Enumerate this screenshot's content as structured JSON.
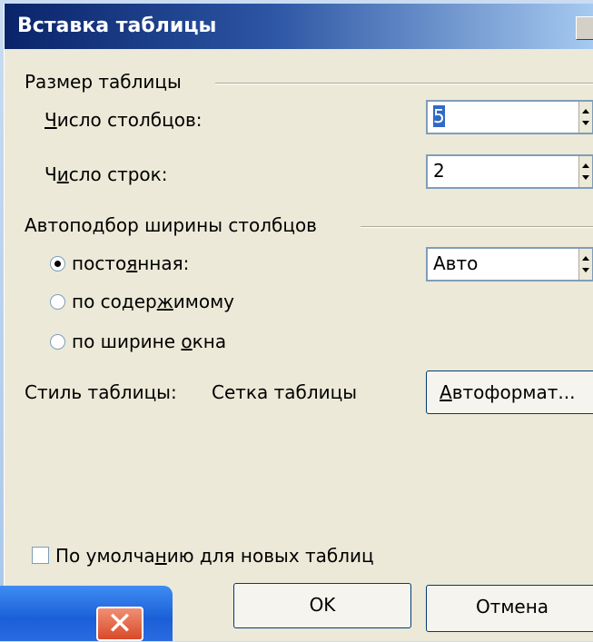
{
  "dialog": {
    "title": "Вставка таблицы",
    "size_group": {
      "label": "Размер таблицы",
      "columns_label": "Число столбцов:",
      "columns_value": "5",
      "rows_label": "Число строк:",
      "rows_value": "2"
    },
    "autofit_group": {
      "label": "Автоподбор ширины столбцов",
      "options": [
        {
          "label": "постоянная:",
          "checked": true
        },
        {
          "label": "по содержимому",
          "checked": false
        },
        {
          "label": "по ширине окна",
          "checked": false
        }
      ],
      "fixed_value": "Авто"
    },
    "style": {
      "label": "Стиль таблицы:",
      "value": "Сетка таблицы",
      "autoformat_button": "Автоформат..."
    },
    "default_checkbox": {
      "label": "По умолчанию для новых таблиц",
      "checked": false
    },
    "ok_button": "OK",
    "cancel_button": "Отмена"
  },
  "taskbar": {
    "close_icon": "close-icon"
  }
}
